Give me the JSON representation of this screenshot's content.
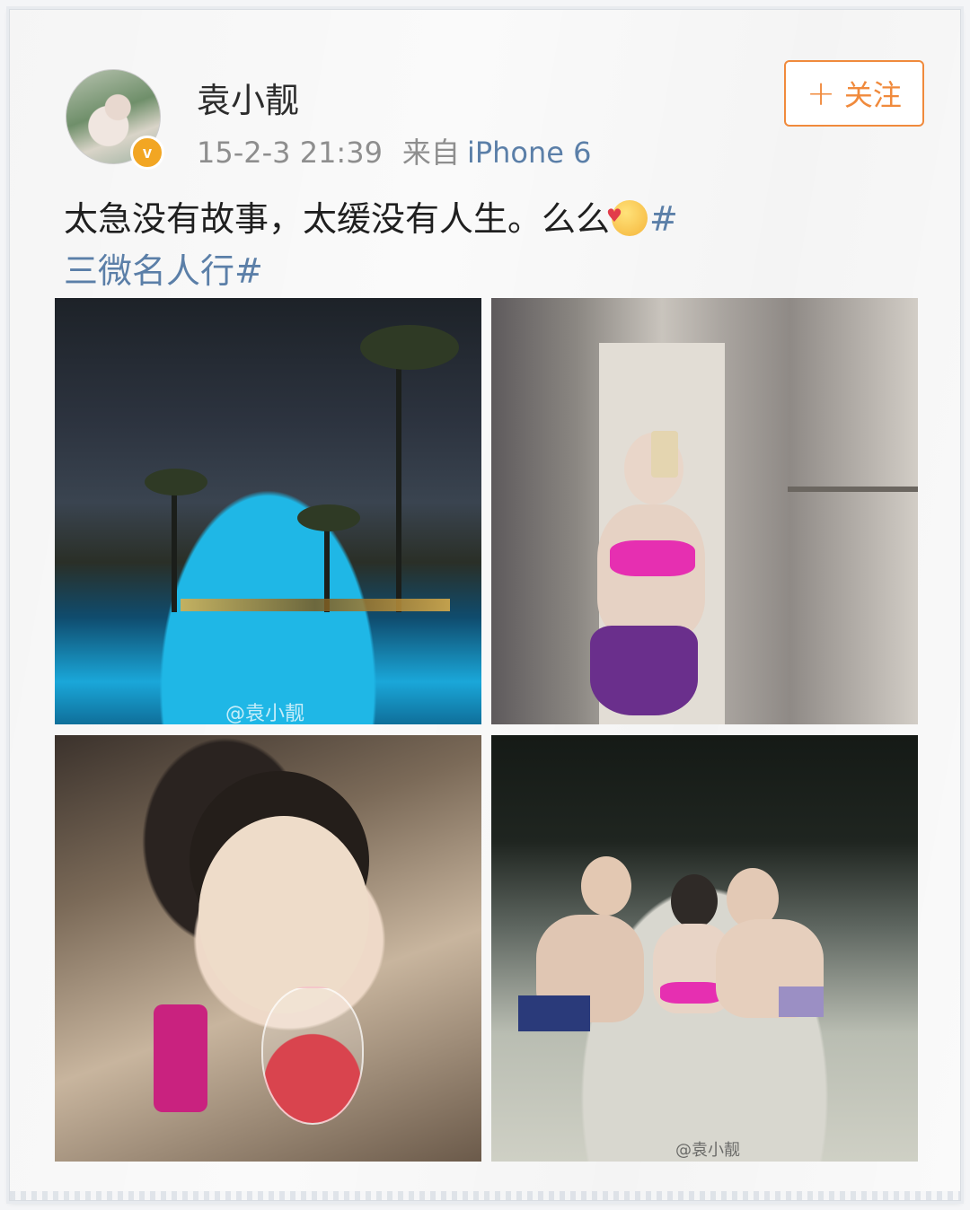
{
  "user": {
    "name": "袁小靓",
    "verified_badge": "v",
    "timestamp": "15-2-3 21:39",
    "source_prefix": "来自",
    "device": "iPhone 6"
  },
  "follow_button": {
    "plus": "+",
    "label": "关注"
  },
  "post": {
    "text": "太急没有故事，太缓没有人生。么么",
    "emoji": "kiss-face-emoji",
    "hashtag_open": "#",
    "hashtag": "三微名人行#"
  },
  "photos": {
    "watermark_1": "@袁小靓",
    "watermark_4": "@袁小靓"
  },
  "colors": {
    "accent_orange": "#f08a3c",
    "link_blue": "#5b7fa8",
    "verified_gold": "#f2a623"
  }
}
